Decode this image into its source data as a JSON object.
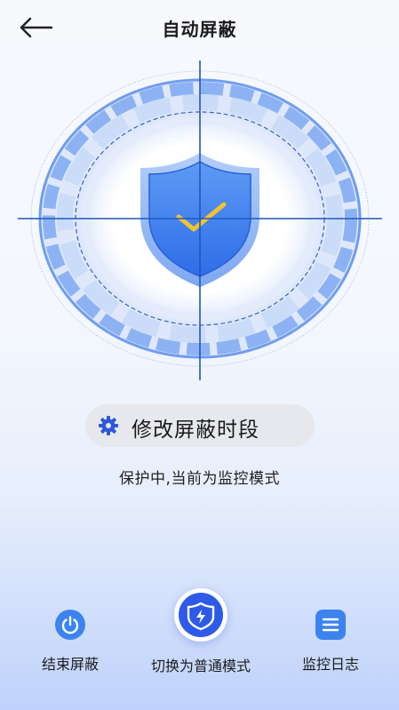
{
  "header": {
    "title": "自动屏蔽"
  },
  "shield": {
    "status_icon": "shield-check-icon"
  },
  "edit_schedule": {
    "label": "修改屏蔽时段"
  },
  "status_text": "保护中,当前为监控模式",
  "actions": [
    {
      "label": "结束屏蔽",
      "icon": "power-icon"
    },
    {
      "label": "切换为普通模式",
      "icon": "shield-bolt-icon"
    },
    {
      "label": "监控日志",
      "icon": "list-icon"
    }
  ],
  "colors": {
    "accent": "#3c83f0",
    "shield": "#3b7df0",
    "check": "#f2c230",
    "mode_button": "#2d5ae6"
  }
}
